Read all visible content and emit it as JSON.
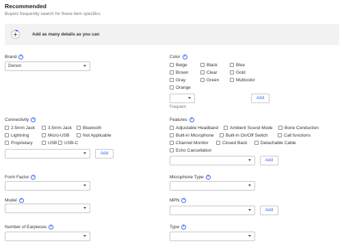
{
  "header": {
    "title": "Recommended",
    "subtitle": "Buyers frequently search for these item specifics"
  },
  "banner": {
    "text": "Add as many details as you can",
    "progress": 0.1
  },
  "brand": {
    "label": "Brand",
    "value": "Denon"
  },
  "color": {
    "label": "Color",
    "rows": [
      [
        "Beige",
        "Black",
        "Blue"
      ],
      [
        "Brown",
        "Clear",
        "Gold"
      ],
      [
        "Gray",
        "Green",
        "Multicolor"
      ],
      [
        "Orange"
      ]
    ],
    "select_value": "",
    "add_label": "Add",
    "hint": "Frequent"
  },
  "connectivity": {
    "label": "Connectivity",
    "rows": [
      [
        "2.5mm Jack",
        "3.5mm Jack",
        "Bluetooth"
      ],
      [
        "Lightning",
        "Micro-USB",
        "Not Applicable"
      ],
      [
        "Proprietary",
        "USB",
        "USB-C"
      ]
    ],
    "add_label": "Add"
  },
  "features": {
    "label": "Features",
    "rows": [
      [
        "Adjustable Headband",
        "Ambient Sound Mode",
        "Bone Conduction"
      ],
      [
        "Built-in Microphone",
        "Built-in On/Off Switch",
        "Call functions"
      ],
      [
        "Channel Monitor",
        "Closed Back",
        "Detachable Cable"
      ],
      [
        "Echo Cancellation"
      ]
    ],
    "add_label": "Add"
  },
  "form_factor": {
    "label": "Form Factor"
  },
  "microphone_type": {
    "label": "Microphone Type"
  },
  "model": {
    "label": "Model"
  },
  "mpn": {
    "label": "MPN",
    "add_label": "Add"
  },
  "number_of_earpieces": {
    "label": "Number of Earpieces"
  },
  "type": {
    "label": "Type"
  },
  "colors": {
    "accent": "#3665f3",
    "banner_bg": "#f2f2f2",
    "border": "#c7c7c7"
  }
}
